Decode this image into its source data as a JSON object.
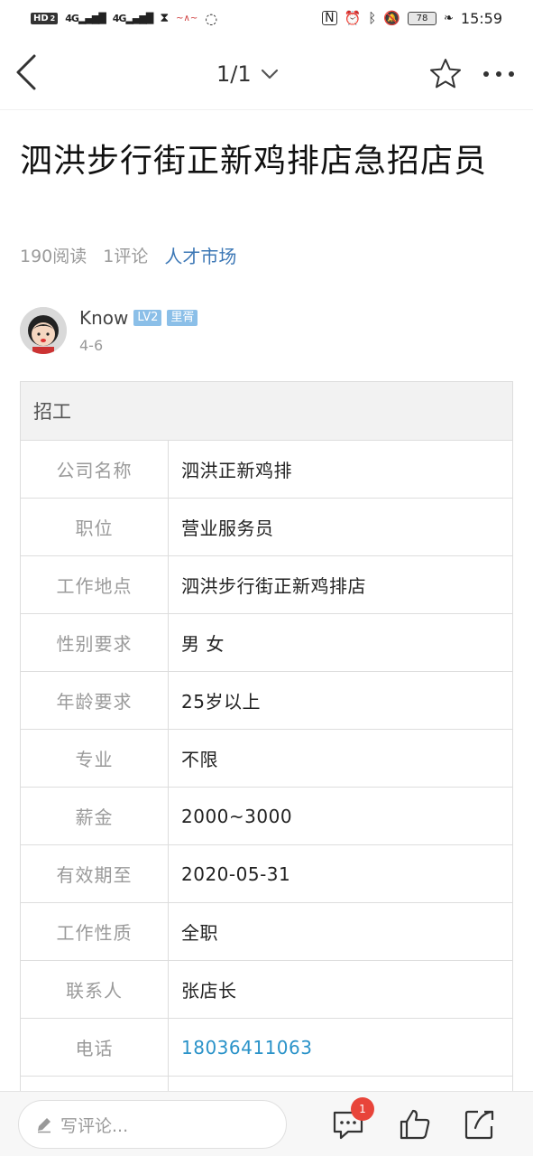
{
  "status_bar": {
    "hd": "HD",
    "hd_sub": "2",
    "net1": "4G",
    "net2": "4G",
    "battery": "78",
    "time": "15:59"
  },
  "nav": {
    "page_indicator": "1/1"
  },
  "post": {
    "title": "泗洪步行街正新鸡排店急招店员",
    "reads": "190阅读",
    "comments": "1评论",
    "category": "人才市场",
    "author": "Know",
    "level_badge": "LV2",
    "title_badge": "里胥",
    "date": "4-6"
  },
  "table": {
    "header": "招工",
    "rows": [
      {
        "label": "公司名称",
        "value": "泗洪正新鸡排"
      },
      {
        "label": "职位",
        "value": "营业服务员"
      },
      {
        "label": "工作地点",
        "value": "泗洪步行街正新鸡排店"
      },
      {
        "label": "性别要求",
        "value": "男 女"
      },
      {
        "label": "年龄要求",
        "value": "25岁以上"
      },
      {
        "label": "专业",
        "value": "不限"
      },
      {
        "label": "薪金",
        "value": "2000~3000"
      },
      {
        "label": "有效期至",
        "value": "2020-05-31"
      },
      {
        "label": "工作性质",
        "value": "全职"
      },
      {
        "label": "联系人",
        "value": "张店长"
      },
      {
        "label": "电话",
        "value": "18036411063"
      },
      {
        "label": "",
        "value": ""
      }
    ]
  },
  "bottom_bar": {
    "comment_placeholder": "写评论...",
    "comment_count_badge": "1"
  }
}
